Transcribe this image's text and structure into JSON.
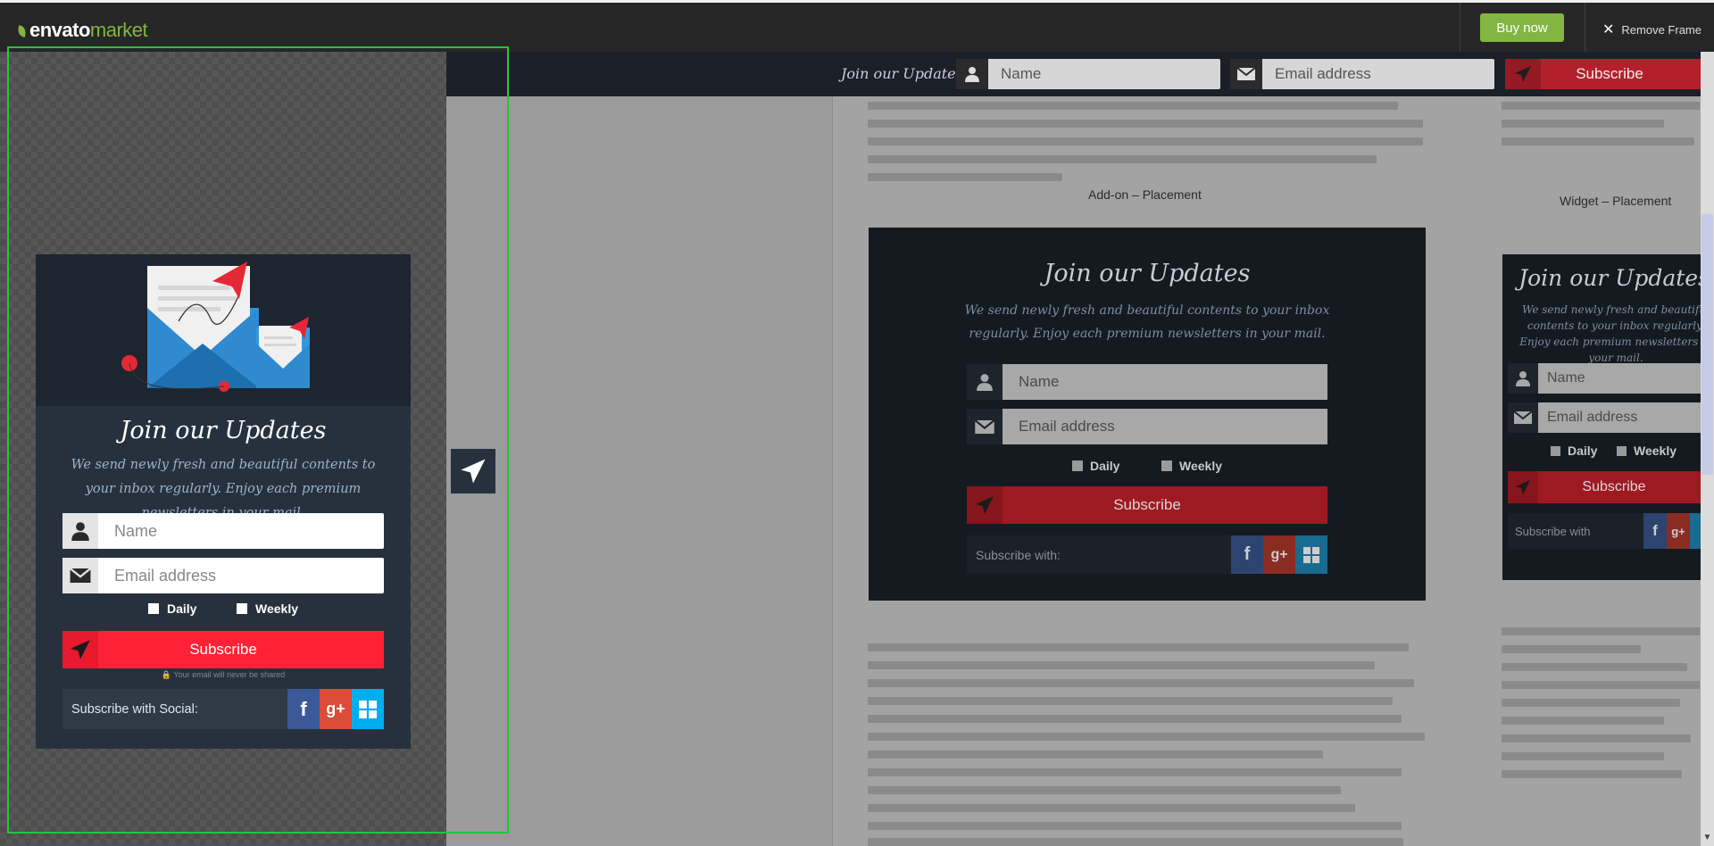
{
  "topbar": {
    "logo_envato": "envato",
    "logo_market": "market",
    "buy_now": "Buy now",
    "remove_frame": "Remove Frame"
  },
  "header": {
    "title": "Join our Updates",
    "name_placeholder": "Name",
    "email_placeholder": "Email address",
    "subscribe": "Subscribe"
  },
  "addon": {
    "caption": "Add-on – Placement",
    "title": "Join our Updates",
    "desc": "We send newly fresh and beautiful contents to your inbox regularly. Enjoy each premium newsletters in your mail.",
    "name_placeholder": "Name",
    "email_placeholder": "Email address",
    "daily": "Daily",
    "weekly": "Weekly",
    "subscribe": "Subscribe",
    "social": "Subscribe with:"
  },
  "widget": {
    "caption": "Widget – Placement",
    "title": "Join our Updates",
    "desc": "We send newly fresh and beautiful contents to your inbox regularly. Enjoy each premium newsletters in your mail.",
    "name_placeholder": "Name",
    "email_placeholder": "Email address",
    "daily": "Daily",
    "weekly": "Weekly",
    "subscribe": "Subscribe",
    "social": "Subscribe with"
  },
  "popup": {
    "title": "Join our Updates",
    "desc": "We send newly fresh and beautiful contents to your inbox regularly. Enjoy each premium newsletters in your mail.",
    "name_placeholder": "Name",
    "email_placeholder": "Email address",
    "daily": "Daily",
    "weekly": "Weekly",
    "subscribe": "Subscribe",
    "note": "Your email will never be shared",
    "social": "Subscribe with Social:",
    "social_icons": [
      "facebook-icon",
      "google-plus-icon",
      "windows-icon"
    ]
  },
  "colors": {
    "envato_green": "#82b541",
    "subscribe_red": "#ff2236",
    "focus_frame": "#22c53a",
    "facebook": "#3b5998",
    "google_plus": "#dd4b39",
    "windows": "#00adef"
  }
}
